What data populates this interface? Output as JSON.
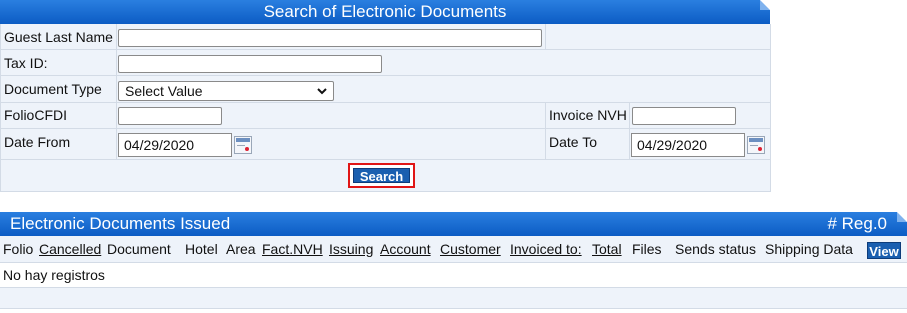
{
  "search_panel": {
    "title": "Search of Electronic Documents",
    "guest_last_name_label": "Guest Last Name",
    "guest_last_name_value": "",
    "tax_id_label": "Tax ID:",
    "tax_id_value": "",
    "document_type_label": "Document Type",
    "document_type_selected": "Select Value",
    "folio_cfdi_label": "FolioCFDI",
    "folio_cfdi_value": "",
    "invoice_nvh_label": "Invoice NVH",
    "invoice_nvh_value": "",
    "date_from_label": "Date From",
    "date_from_value": "04/29/2020",
    "date_to_label": "Date To",
    "date_to_value": "04/29/2020",
    "search_button": "Search"
  },
  "issued_panel": {
    "title": "Electronic Documents Issued",
    "reg_count": "# Reg.0",
    "columns": [
      {
        "label": "Folio",
        "sortable": false
      },
      {
        "label": "Cancelled",
        "sortable": true
      },
      {
        "label": "Document",
        "sortable": false
      },
      {
        "label": "Hotel",
        "sortable": false
      },
      {
        "label": "Area",
        "sortable": false
      },
      {
        "label": "Fact.NVH",
        "sortable": true
      },
      {
        "label": "Issuing",
        "sortable": true
      },
      {
        "label": "Account",
        "sortable": true
      },
      {
        "label": "Customer",
        "sortable": true
      },
      {
        "label": "Invoiced to:",
        "sortable": true
      },
      {
        "label": "Total",
        "sortable": true
      },
      {
        "label": "Files",
        "sortable": false
      },
      {
        "label": "Sends status",
        "sortable": false
      },
      {
        "label": "Shipping Data",
        "sortable": false
      }
    ],
    "view_button": "View",
    "empty_message": "No hay registros"
  },
  "colors": {
    "header_blue": "#0c5cc4",
    "button_blue": "#1a5fb0",
    "highlight_red": "#e01515",
    "row_bg": "#eef3fa"
  }
}
